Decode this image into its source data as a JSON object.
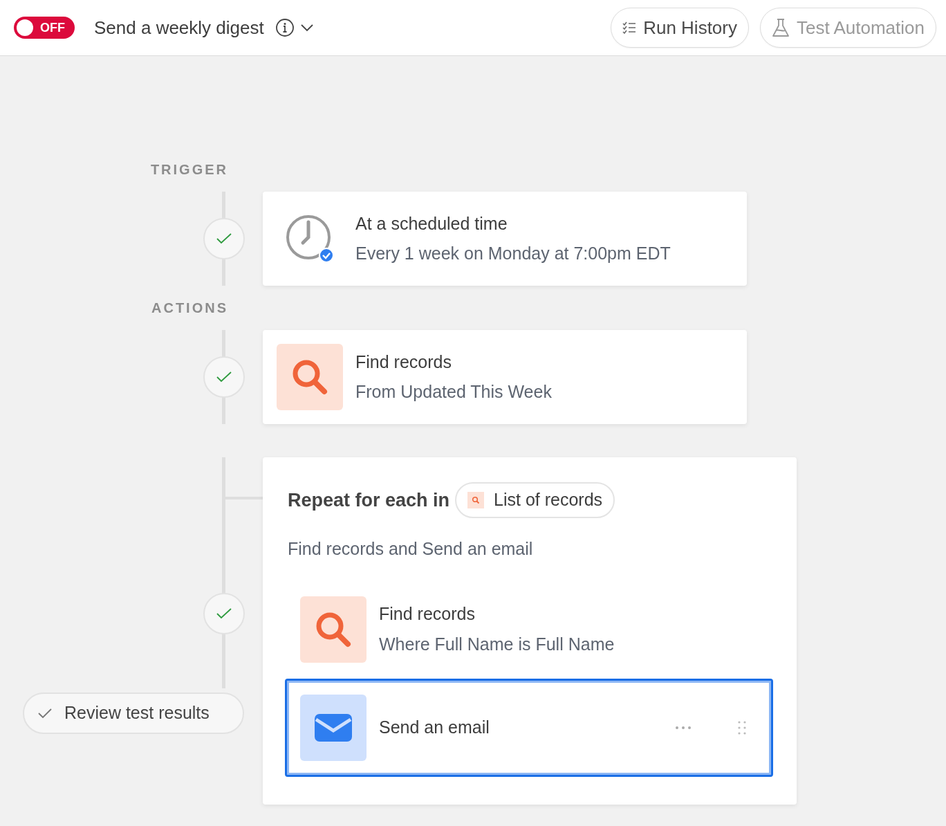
{
  "header": {
    "toggle": {
      "label": "OFF",
      "on": false
    },
    "title": "Send a weekly digest",
    "buttons": [
      {
        "label": "Run History",
        "kind": "history",
        "disabled": false
      },
      {
        "label": "Test Automation",
        "kind": "test",
        "disabled": true
      }
    ]
  },
  "sections": [
    {
      "label": "TRIGGER",
      "steps": [
        {
          "kind": "schedule",
          "title": "At a scheduled time",
          "subtitle": "Every 1 week on Monday at 7:00pm EDT",
          "tested": true
        }
      ]
    },
    {
      "label": "ACTIONS",
      "steps": [
        {
          "kind": "find",
          "title": "Find records",
          "subtitle": "From Updated This Week",
          "tested": true
        },
        {
          "kind": "loop",
          "title": "Repeat for each in",
          "source": "List of records",
          "description": "Find records and Send an email",
          "tested": true,
          "steps": [
            {
              "kind": "find",
              "title": "Find records",
              "subtitle": "Where Full Name is Full Name",
              "selected": false
            },
            {
              "kind": "email",
              "title": "Send an email",
              "selected": true
            }
          ]
        }
      ]
    }
  ],
  "review_button": "Review test results"
}
